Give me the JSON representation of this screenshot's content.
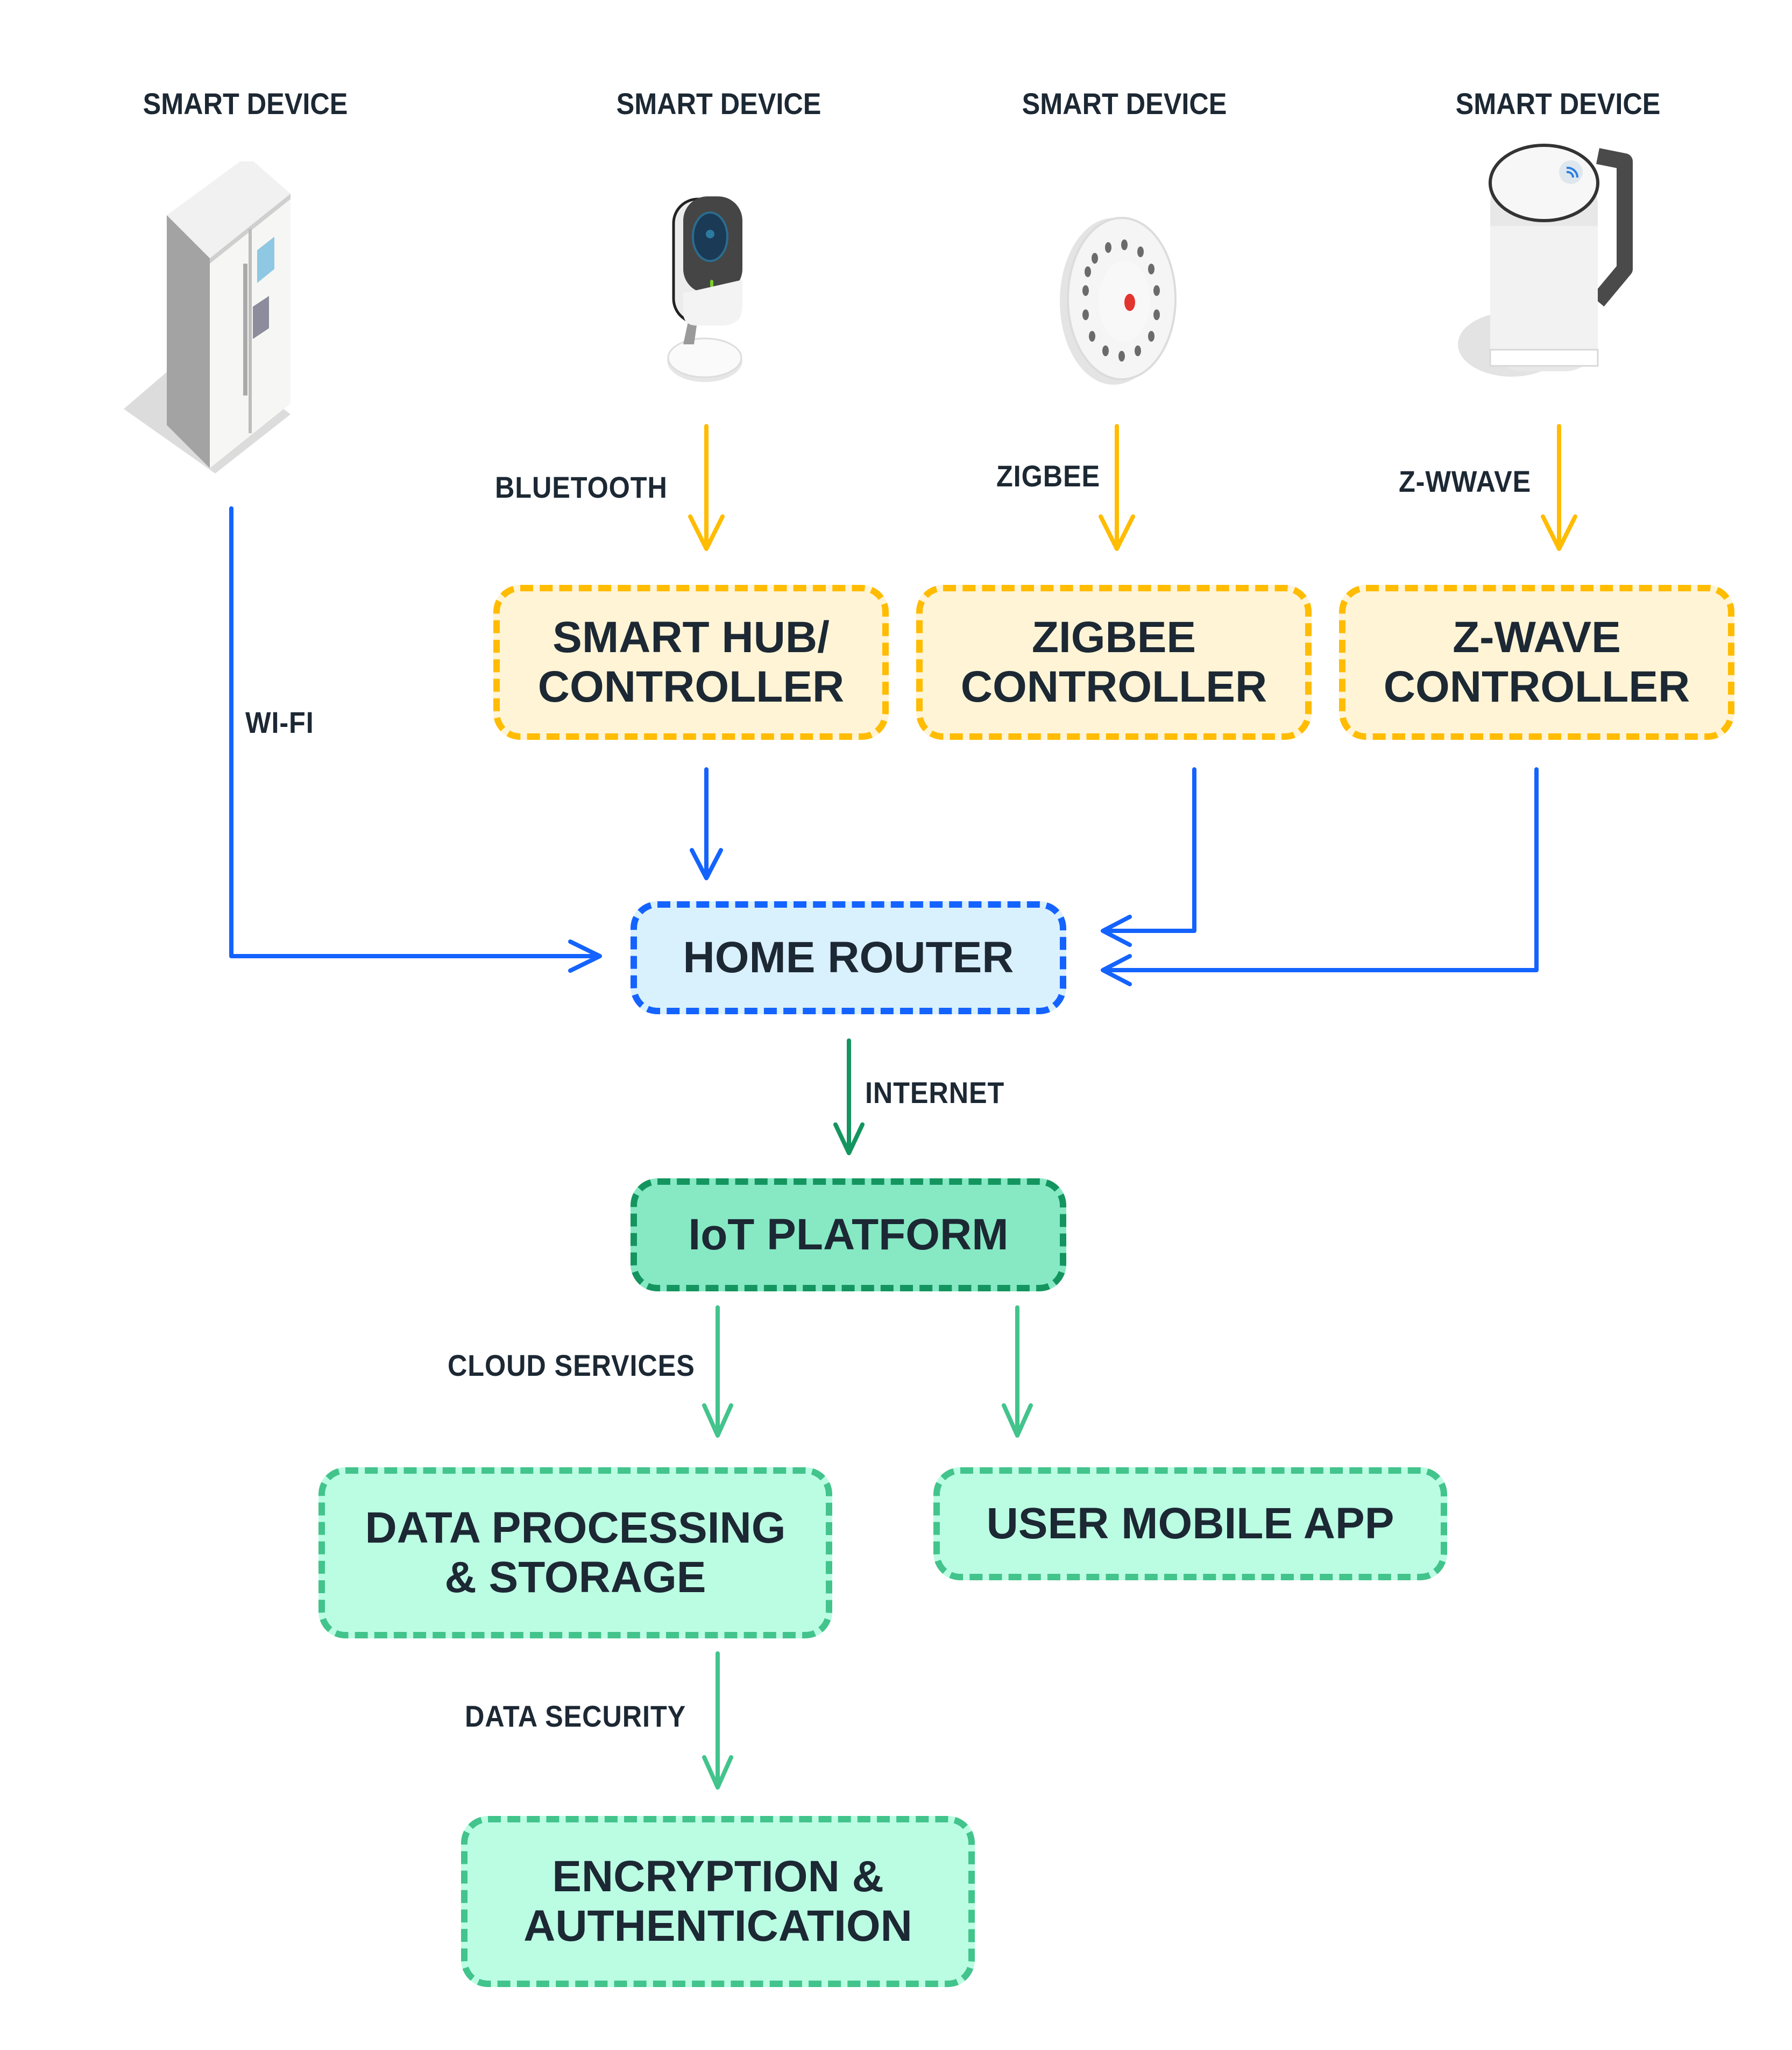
{
  "devices": [
    {
      "title": "SMART DEVICE",
      "kind": "refrigerator"
    },
    {
      "title": "SMART DEVICE",
      "kind": "security-camera"
    },
    {
      "title": "SMART DEVICE",
      "kind": "smoke-detector"
    },
    {
      "title": "SMART DEVICE",
      "kind": "smart-kettle"
    }
  ],
  "connections": {
    "wifi": "WI-FI",
    "bluetooth": "BLUETOOTH",
    "zigbee": "ZIGBEE",
    "zwave": "Z-WWAVE",
    "internet": "INTERNET",
    "cloud": "CLOUD SERVICES",
    "security": "DATA SECURITY"
  },
  "nodes": {
    "hub": {
      "line1": "SMART HUB/",
      "line2": "CONTROLLER"
    },
    "zigbee": {
      "line1": "ZIGBEE",
      "line2": "CONTROLLER"
    },
    "zwave": {
      "line1": "Z-WAVE",
      "line2": "CONTROLLER"
    },
    "router": {
      "label": "HOME ROUTER"
    },
    "platform": {
      "label": "IoT PLATFORM"
    },
    "processing": {
      "line1": "DATA PROCESSING",
      "line2": "& STORAGE"
    },
    "mobile": {
      "label": "USER MOBILE APP"
    },
    "encryption": {
      "line1": "ENCRYPTION &",
      "line2": "AUTHENTICATION"
    }
  },
  "colors": {
    "text": "#1c2833",
    "controller_stroke": "#ffbc00",
    "controller_fill": "#fff4d6",
    "router_stroke": "#1463ff",
    "router_fill": "#d9f0fd",
    "platform_stroke": "#14955f",
    "platform_fill": "#86e9c4",
    "service_stroke": "#42c48c",
    "service_fill": "#bbfde3"
  }
}
